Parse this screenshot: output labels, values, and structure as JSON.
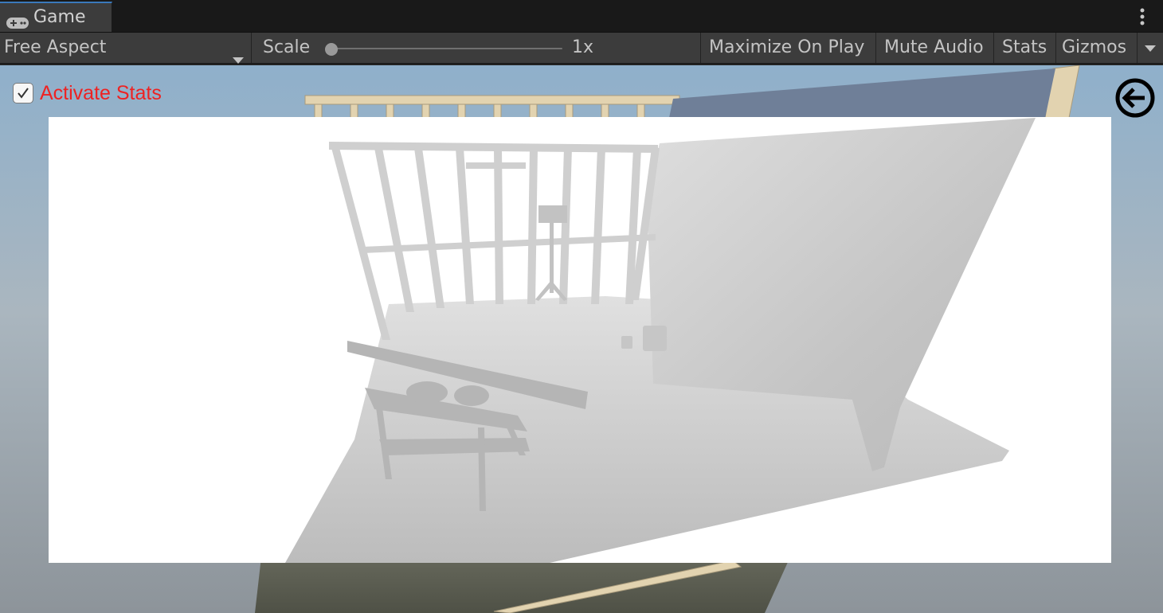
{
  "window": {
    "tab_label": "Game",
    "tab_icon": "gamepad-icon",
    "menu_icon": "kebab-menu-icon"
  },
  "toolbar": {
    "aspect_label": "Free Aspect",
    "scale_label": "Scale",
    "scale_value": "1x",
    "scale_slider_position": 0,
    "maximize_label": "Maximize On Play",
    "mute_label": "Mute Audio",
    "stats_label": "Stats",
    "gizmos_label": "Gizmos"
  },
  "game_view": {
    "activate_stats_label": "Activate Stats",
    "activate_stats_checked": true,
    "back_icon": "arrow-left-circle-icon",
    "label_color": "#ee2222"
  },
  "colors": {
    "tab_accent": "#3a79bb",
    "panel": "#3c3c3c",
    "sky": "#9fb6c8"
  }
}
